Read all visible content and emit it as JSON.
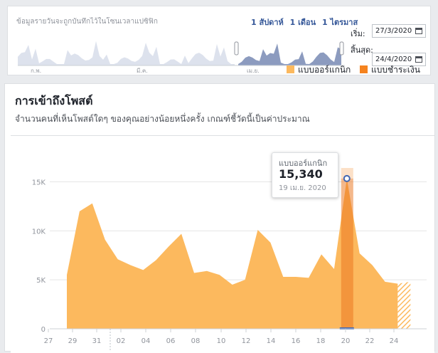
{
  "top_panel": {
    "caption": "ข้อมูลรายวันจะถูกบันทึกไว้ในโซนเวลาแปซิฟิก",
    "range_links": [
      "1 สัปดาห์",
      "1 เดือน",
      "1 ไตรมาส"
    ],
    "start_label": "เริ่ม:",
    "start_value": "27/3/2020",
    "end_label": "สิ้นสุด:",
    "end_value": "24/4/2020",
    "mini_axis_labels": [
      "ก.พ.",
      "มี.ค.",
      "เม.ย."
    ],
    "calendar_icon": "calendar-icon"
  },
  "main_panel": {
    "title": "การเข้าถึงโพสต์",
    "subtitle": "จำนวนคนที่เห็นโพสต์ใดๆ ของคุณอย่างน้อยหนึ่งครั้ง เกณฑ์ชี้วัดนี้เป็นค่าประมาณ"
  },
  "tooltip": {
    "series": "แบบออร์แกนิก",
    "value": "15,340",
    "date": "19 เม.ย. 2020"
  },
  "colors": {
    "organic": "#fcb95e",
    "paid": "#f5831f",
    "link": "#365899",
    "mini_fill": "#8c9bbf"
  },
  "chart_data": {
    "type": "area",
    "series": [
      {
        "name": "แบบออร์แกนิก",
        "values": [
          5500,
          12000,
          12800,
          9100,
          7100,
          6500,
          6000,
          7000,
          8400,
          9700,
          5700,
          5900,
          5500,
          4500,
          5000,
          10100,
          8800,
          5300,
          5300,
          5200,
          7600,
          6100,
          15340,
          7700,
          6500,
          4800,
          4600,
          4800
        ]
      },
      {
        "name": "แบบชำระเงิน",
        "values": [
          0,
          0,
          0,
          0,
          0,
          0,
          0,
          0,
          0,
          0,
          0,
          0,
          0,
          0,
          0,
          0,
          0,
          0,
          0,
          0,
          0,
          0,
          0,
          0,
          0,
          0,
          0,
          0
        ]
      }
    ],
    "x_tick_labels": [
      "27",
      "29",
      "31",
      "02",
      "04",
      "06",
      "08",
      "10",
      "12",
      "14",
      "16",
      "18",
      "20",
      "22",
      "24"
    ],
    "y_tick_labels": [
      "0",
      "5K",
      "10K",
      "15K"
    ],
    "ylim": [
      0,
      17000
    ],
    "highlight_day": "20",
    "legend_position": "top-right"
  }
}
